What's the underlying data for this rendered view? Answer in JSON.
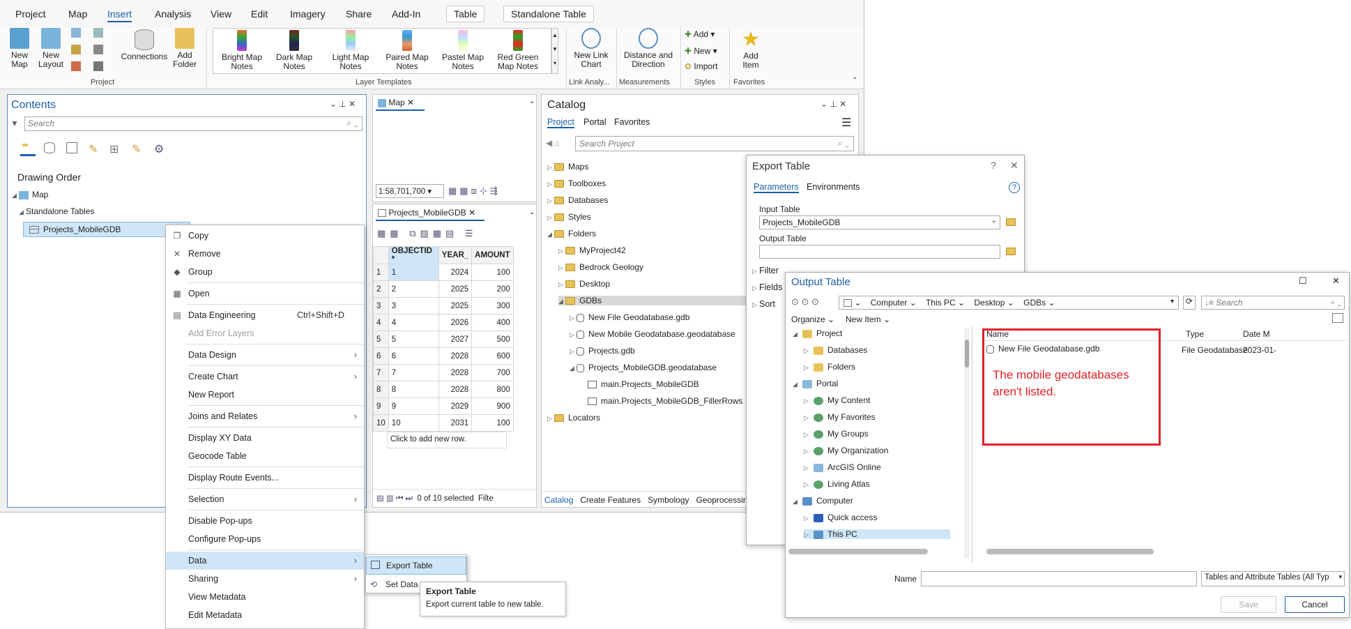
{
  "menubar": {
    "items": [
      "Project",
      "Map",
      "Insert",
      "Analysis",
      "View",
      "Edit",
      "Imagery",
      "Share",
      "Add-In"
    ],
    "active": "Insert",
    "context_tabs": [
      "Table",
      "Standalone Table"
    ]
  },
  "ribbon": {
    "project": {
      "new_map": "New Map",
      "new_layout": "New Layout",
      "connections": "Connections",
      "add_folder": "Add Folder",
      "group": "Project"
    },
    "templates": [
      "Bright Map Notes",
      "Dark Map Notes",
      "Light Map Notes",
      "Paired Map Notes",
      "Pastel Map Notes",
      "Red Green Map Notes"
    ],
    "templates_group": "Layer Templates",
    "new_link_chart": "New Link Chart",
    "link_group": "Link Analy...",
    "distance": "Distance and Direction",
    "measure_group": "Measurements",
    "styles": {
      "add": "Add",
      "new": "New",
      "import": "Import",
      "group": "Styles"
    },
    "favorites": {
      "add_item": "Add Item",
      "group": "Favorites"
    }
  },
  "contents": {
    "title": "Contents",
    "search_placeholder": "Search",
    "drawing_order": "Drawing Order",
    "map": "Map",
    "standalone": "Standalone Tables",
    "table": "Projects_MobileGDB"
  },
  "context_menu": {
    "items": [
      {
        "label": "Copy",
        "icon": "copy-icon"
      },
      {
        "label": "Remove",
        "icon": "remove-icon"
      },
      {
        "label": "Group",
        "icon": "group-icon"
      },
      {
        "label": "Open",
        "icon": "table-icon"
      },
      {
        "label": "Data Engineering",
        "shortcut": "Ctrl+Shift+D",
        "icon": "data-engineering-icon"
      },
      {
        "label": "Add Error Layers",
        "disabled": true
      },
      {
        "label": "Data Design",
        "submenu": true
      },
      {
        "label": "Create Chart",
        "submenu": true
      },
      {
        "label": "New Report"
      },
      {
        "label": "Joins and Relates",
        "submenu": true
      },
      {
        "label": "Display XY Data"
      },
      {
        "label": "Geocode Table"
      },
      {
        "label": "Display Route Events..."
      },
      {
        "label": "Selection",
        "submenu": true
      },
      {
        "label": "Disable Pop-ups"
      },
      {
        "label": "Configure Pop-ups"
      },
      {
        "label": "Data",
        "submenu": true,
        "highlight": true
      },
      {
        "label": "Sharing",
        "submenu": true
      },
      {
        "label": "View Metadata"
      },
      {
        "label": "Edit Metadata"
      }
    ]
  },
  "submenu": {
    "export_table": "Export Table",
    "set_data": "Set Data"
  },
  "tooltip": {
    "title": "Export Table",
    "text": "Export current table to new table."
  },
  "map_view": {
    "tab": "Map",
    "scale": "1:58,701,700"
  },
  "table_view": {
    "tab": "Projects_MobileGDB",
    "columns": [
      "OBJECTID *",
      "YEAR_",
      "AMOUNT"
    ],
    "rows": [
      [
        1,
        1,
        2024,
        100
      ],
      [
        2,
        2,
        2025,
        200
      ],
      [
        3,
        3,
        2025,
        300
      ],
      [
        4,
        4,
        2026,
        400
      ],
      [
        5,
        5,
        2027,
        500
      ],
      [
        6,
        6,
        2028,
        600
      ],
      [
        7,
        7,
        2028,
        700
      ],
      [
        8,
        8,
        2028,
        800
      ],
      [
        9,
        9,
        2029,
        900
      ],
      [
        10,
        10,
        2031,
        100
      ]
    ],
    "add_row": "Click to add new row.",
    "status": "0 of 10 selected",
    "filter": "Filte"
  },
  "catalog": {
    "title": "Catalog",
    "tabs": [
      "Project",
      "Portal",
      "Favorites"
    ],
    "search_placeholder": "Search Project",
    "items": [
      "Maps",
      "Toolboxes",
      "Databases",
      "Styles",
      "Folders",
      "MyProject42",
      "Bedrock Geology",
      "Desktop",
      "GDBs",
      "New File Geodatabase.gdb",
      "New Mobile Geodatabase.geodatabase",
      "Projects.gdb",
      "Projects_MobileGDB.geodatabase",
      "main.Projects_MobileGDB",
      "main.Projects_MobileGDB_FillerRows",
      "Locators"
    ],
    "bottom_tabs": [
      "Catalog",
      "Create Features",
      "Symbology",
      "Geoprocessin"
    ]
  },
  "export_tool": {
    "title": "Export Table",
    "help": "?",
    "tabs": [
      "Parameters",
      "Environments"
    ],
    "input_label": "Input Table",
    "input_value": "Projects_MobileGDB",
    "output_label": "Output Table",
    "output_value": "",
    "sections": [
      "Filter",
      "Fields",
      "Sort"
    ]
  },
  "output_dialog": {
    "title": "Output Table",
    "path": [
      "Computer",
      "This PC",
      "Desktop",
      "GDBs"
    ],
    "search_placeholder": "Search",
    "organize": "Organize",
    "new_item": "New Item",
    "tree": [
      "Project",
      "Databases",
      "Folders",
      "Portal",
      "My Content",
      "My Favorites",
      "My Groups",
      "My Organization",
      "ArcGIS Online",
      "Living Atlas",
      "Computer",
      "Quick access",
      "This PC"
    ],
    "columns": [
      "Name",
      "Type",
      "Date M"
    ],
    "file": {
      "name": "New File Geodatabase.gdb",
      "type": "File Geodatabase",
      "date": "2023-01-"
    },
    "annotation": "The mobile geodatabases aren't listed.",
    "name_label": "Name",
    "filter": "Tables and Attribute Tables (All Typ",
    "save": "Save",
    "cancel": "Cancel"
  },
  "colors": {
    "accent": "#1a5fa8",
    "annotation": "#e21f26",
    "highlight": "#cfe6f8"
  }
}
